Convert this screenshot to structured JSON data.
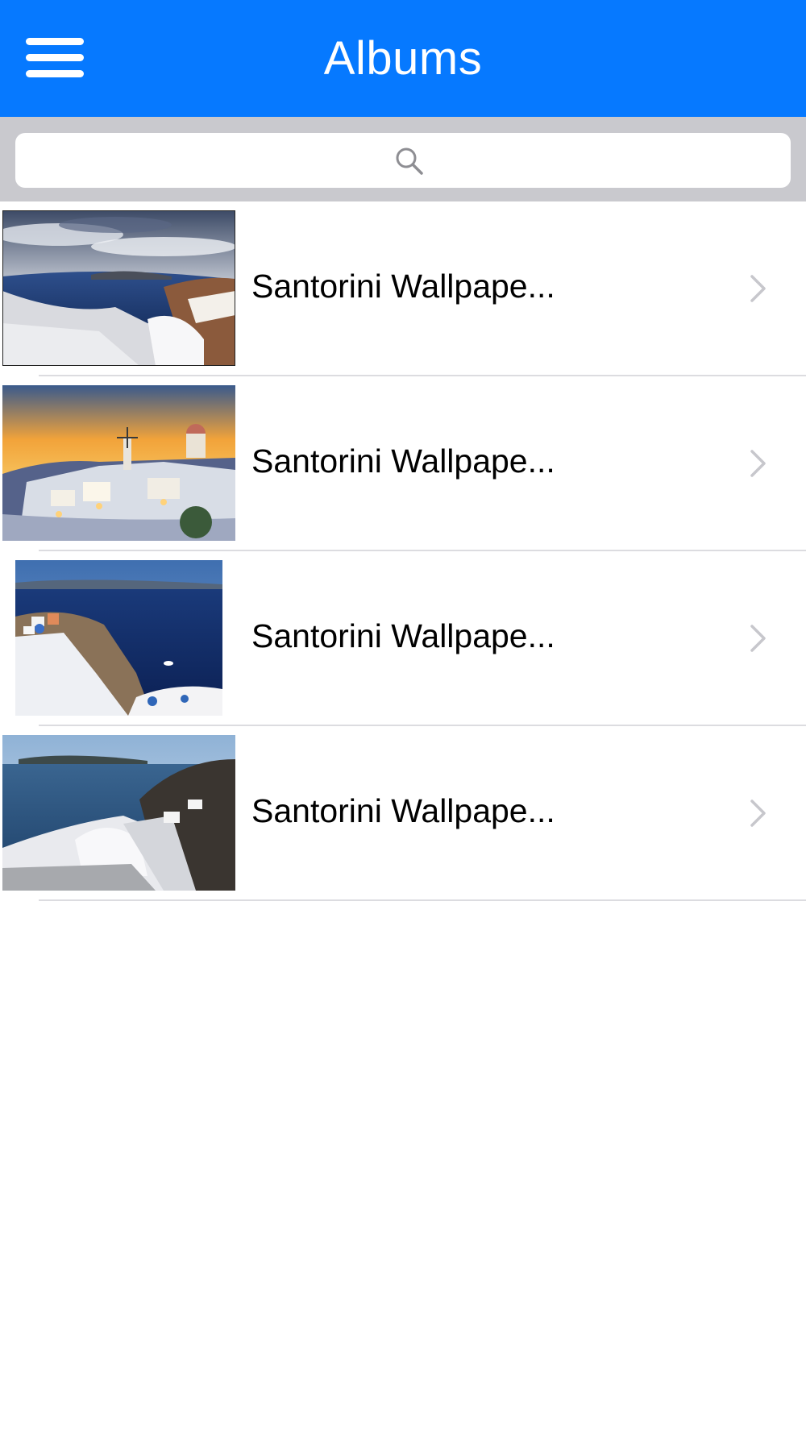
{
  "navbar": {
    "title": "Albums",
    "menu_icon": "hamburger-menu-icon",
    "background_color": "#0679FF"
  },
  "search": {
    "placeholder": "",
    "value": "",
    "icon": "search-icon",
    "background_color": "#C9C9CE"
  },
  "albums": [
    {
      "label": "Santorini Wallpape...",
      "thumb_scene": "panorama-clouds-sea",
      "chevron_icon": "chevron-right-icon"
    },
    {
      "label": "Santorini Wallpape...",
      "thumb_scene": "sunset-windmill-village",
      "chevron_icon": "chevron-right-icon"
    },
    {
      "label": "Santorini Wallpape...",
      "thumb_scene": "deep-blue-caldera",
      "chevron_icon": "chevron-right-icon"
    },
    {
      "label": "Santorini Wallpape...",
      "thumb_scene": "white-stairs-sea",
      "chevron_icon": "chevron-right-icon"
    }
  ]
}
